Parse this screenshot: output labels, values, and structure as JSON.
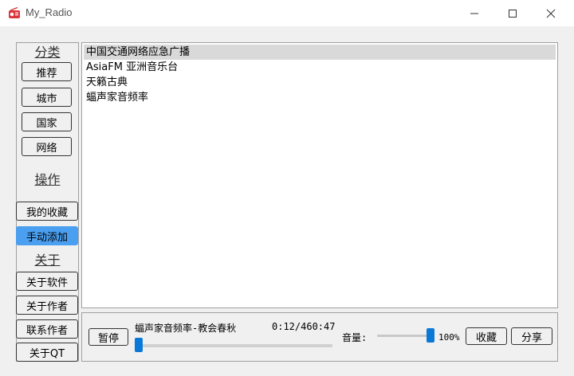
{
  "window": {
    "title": "My_Radio"
  },
  "sidebar": {
    "category_title": "分类",
    "category_buttons": [
      "推荐",
      "城市",
      "国家",
      "网络"
    ],
    "operation_title": "操作",
    "operation_buttons": [
      "我的收藏",
      "手动添加"
    ],
    "about_title": "关于",
    "about_buttons": [
      "关于软件",
      "关于作者",
      "联系作者",
      "关于QT"
    ],
    "active_button": "手动添加"
  },
  "stations": [
    "中国交通网络应急广播",
    "AsiaFM 亚洲音乐台",
    "天籁古典",
    "蝠声家音频率"
  ],
  "selected_station": "中国交通网络应急广播",
  "player": {
    "pause_label": "暂停",
    "now_playing": "蝠声家音频率-教会春秋",
    "time": "0:12/460:47",
    "progress_fraction": 0.0,
    "volume_label": "音量:",
    "volume_percent": "100%",
    "volume_fraction": 1.0,
    "favorite_label": "收藏",
    "share_label": "分享"
  },
  "colors": {
    "accent": "#0a78d7",
    "active_button": "#4a9ff0",
    "selected_row": "#d9d9d9"
  }
}
